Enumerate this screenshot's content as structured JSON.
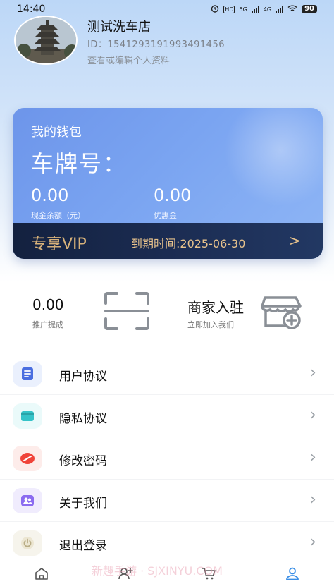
{
  "status_bar": {
    "time": "14:40",
    "net_1": "HD",
    "net_2": "5G",
    "net_3": "4G",
    "battery": "90"
  },
  "profile": {
    "name": "测试洗车店",
    "id_text": "ID：1541293191993491456",
    "edit_link": "查看或编辑个人资料"
  },
  "wallet": {
    "title": "我的钱包",
    "plate_label": "车牌号：",
    "cash_amount": "0.00",
    "cash_label": "现金余额（元）",
    "coupon_amount": "0.00",
    "coupon_label": "优惠金",
    "vip_label": "专享VIP",
    "vip_expire": "到期时间:2025-06-30",
    "vip_arrow": ">"
  },
  "promo": {
    "amount": "0.00",
    "label": "推广提成"
  },
  "merchant": {
    "title": "商家入驻",
    "subtitle": "立即加入我们"
  },
  "menu": {
    "items": [
      {
        "label": "用户协议",
        "icon": "document-icon",
        "color": "#4a6ee0",
        "bg": "#eaf0fd"
      },
      {
        "label": "隐私协议",
        "icon": "card-icon",
        "color": "#35c3c8",
        "bg": "#eafafa"
      },
      {
        "label": "修改密码",
        "icon": "lock-icon",
        "color": "#f0443a",
        "bg": "#fdecea"
      },
      {
        "label": "关于我们",
        "icon": "people-icon",
        "color": "#8b6cf0",
        "bg": "#f0ecfd"
      },
      {
        "label": "退出登录",
        "icon": "power-icon",
        "color": "#b9ad86",
        "bg": "#f6f4ec"
      }
    ]
  },
  "watermark": "新趣手游 · SJXINYU.COM",
  "tabbar": {
    "tabs": [
      {
        "icon": "home-icon"
      },
      {
        "icon": "add-user-icon"
      },
      {
        "icon": "cart-icon"
      },
      {
        "icon": "user-icon",
        "active": true
      }
    ],
    "active_color": "#3a8ee6"
  }
}
